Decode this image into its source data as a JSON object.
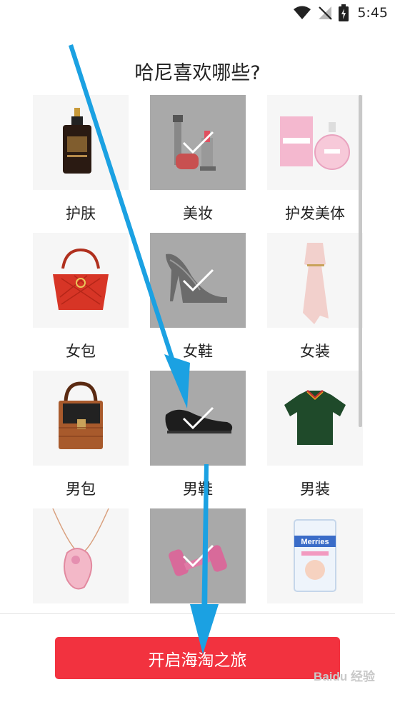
{
  "status_bar": {
    "time": "5:45",
    "icons": [
      "wifi-icon",
      "no-signal-icon",
      "battery-charging-icon"
    ]
  },
  "page": {
    "title": "哈尼喜欢哪些?"
  },
  "categories": [
    {
      "label": "护肤",
      "icon": "serum-bottle-icon",
      "selected": false
    },
    {
      "label": "美妆",
      "icon": "makeup-kit-icon",
      "selected": true
    },
    {
      "label": "护发美体",
      "icon": "perfume-icon",
      "selected": false
    },
    {
      "label": "女包",
      "icon": "handbag-icon",
      "selected": false
    },
    {
      "label": "女鞋",
      "icon": "high-heel-icon",
      "selected": true
    },
    {
      "label": "女装",
      "icon": "dress-icon",
      "selected": false
    },
    {
      "label": "男包",
      "icon": "mens-bag-icon",
      "selected": false
    },
    {
      "label": "男鞋",
      "icon": "dress-shoe-icon",
      "selected": true
    },
    {
      "label": "男装",
      "icon": "polo-shirt-icon",
      "selected": false
    },
    {
      "label": "",
      "icon": "necklace-icon",
      "selected": false
    },
    {
      "label": "",
      "icon": "dumbbell-icon",
      "selected": true
    },
    {
      "label": "",
      "icon": "diaper-pack-icon",
      "selected": false
    }
  ],
  "diaper_pack_text": "Merries",
  "start_button": {
    "label": "开启海淘之旅"
  },
  "watermark": "Baidu 经验",
  "colors": {
    "accent": "#f2323f",
    "annotation_arrow": "#1ba1e2",
    "selected_overlay": "#a9a9a9"
  }
}
